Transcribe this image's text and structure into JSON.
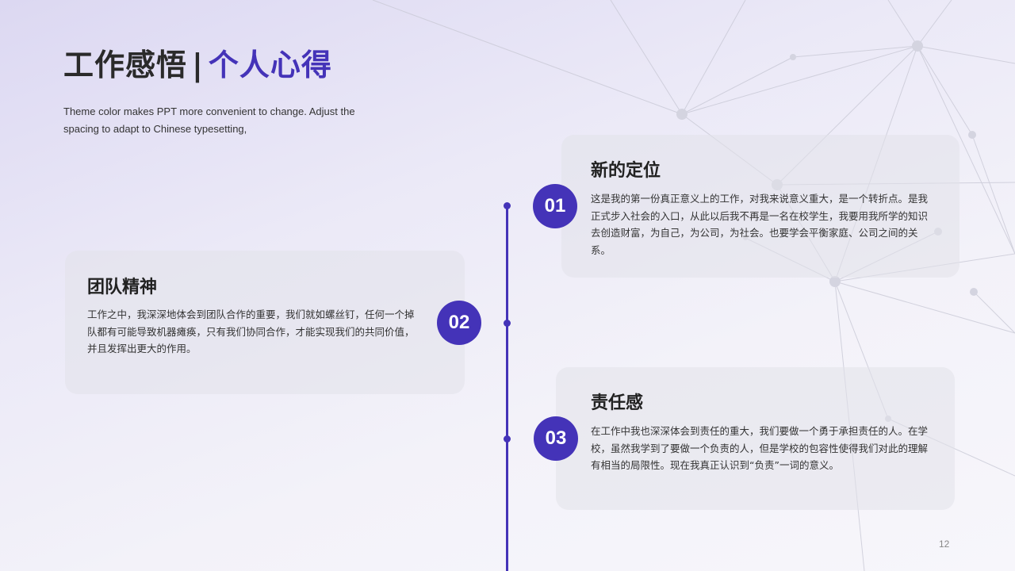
{
  "title": {
    "main": "工作感悟",
    "separator": "|",
    "accent": "个人心得"
  },
  "subtitle": "Theme color makes PPT more convenient to change. Adjust the spacing to adapt to Chinese typesetting,",
  "items": [
    {
      "number": "01",
      "title": "新的定位",
      "body": "这是我的第一份真正意义上的工作，对我来说意义重大，是一个转折点。是我正式步入社会的入口，从此以后我不再是一名在校学生，我要用我所学的知识去创造财富，为自己，为公司，为社会。也要学会平衡家庭、公司之间的关系。"
    },
    {
      "number": "02",
      "title": "团队精神",
      "body": "工作之中，我深深地体会到团队合作的重要，我们就如螺丝钉，任何一个掉队都有可能导致机器瘫痪，只有我们协同合作，才能实现我们的共同价值，并且发挥出更大的作用。"
    },
    {
      "number": "03",
      "title": "责任感",
      "body": "在工作中我也深深体会到责任的重大，我们要做一个勇于承担责任的人。在学校，虽然我学到了要做一个负责的人，但是学校的包容性使得我们对此的理解有相当的局限性。现在我真正认识到“负责”一词的意义。"
    }
  ],
  "page_number": "12",
  "colors": {
    "accent": "#4433b8",
    "text_dark": "#2a2a2a",
    "card_bg": "#e5e5ec"
  }
}
